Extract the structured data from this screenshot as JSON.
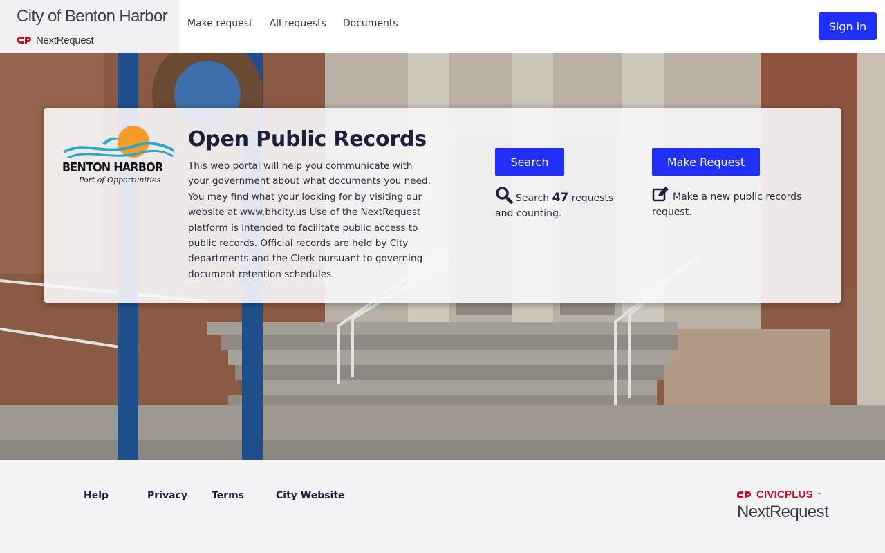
{
  "header": {
    "city_name": "City of Benton Harbor",
    "platform_name": "NextRequest",
    "nav": [
      {
        "label": "Make request"
      },
      {
        "label": "All requests"
      },
      {
        "label": "Documents"
      }
    ],
    "sign_in_label": "Sign in"
  },
  "hero": {
    "logo": {
      "name": "BENTON HARBOR",
      "tagline": "Port of Opportunities",
      "colors": {
        "sun": "#f49b2a",
        "wave": "#2aa8c4"
      }
    },
    "title": "Open Public Records",
    "description_before_link": "This web portal will help you communicate with your government about what documents you need. You may find what your looking for by visiting our website at ",
    "description_link": "www.bhcity.us",
    "description_after_link": " Use of the NextRequest platform is intended to facilitate public access to public records. Official records are held by City departments and the Clerk pursuant to governing document retention schedules.",
    "search": {
      "button_label": "Search",
      "icon": "search-icon",
      "text_before": "Search ",
      "count": "47",
      "text_after": " requests and counting."
    },
    "make_request": {
      "button_label": "Make Request",
      "icon": "edit-icon",
      "text": "Make a new public records request."
    }
  },
  "footer": {
    "links": [
      {
        "label": "Help"
      },
      {
        "label": "Privacy"
      },
      {
        "label": "Terms"
      },
      {
        "label": "City Website"
      }
    ],
    "civicplus_label": "CIVICPLUS",
    "nextrequest_label": "NextRequest"
  },
  "colors": {
    "primary_button": "#1f2ff5",
    "civicplus_red": "#c2122b",
    "title_navy": "#1b1f3b"
  }
}
